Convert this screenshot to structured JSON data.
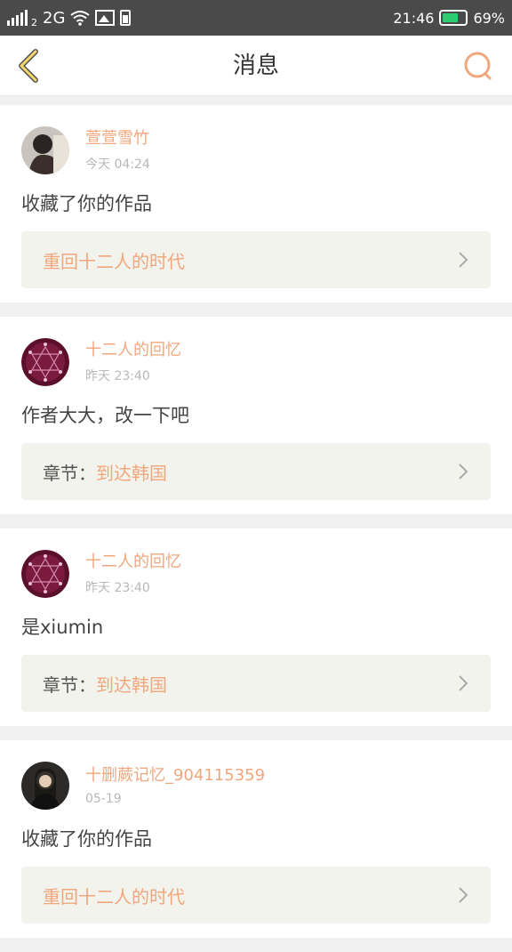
{
  "status_bar": {
    "network": "2G",
    "sim_index": "2",
    "time": "21:46",
    "battery_percent": "69%",
    "battery_level": 0.69,
    "battery_color": "#2ecc71"
  },
  "header": {
    "title": "消息",
    "back_icon": "chevron-left-icon",
    "search_icon": "search-icon",
    "accent": "#f0a77e"
  },
  "messages": [
    {
      "username": "萱萱雪竹",
      "time": "今天 04:24",
      "text": "收藏了你的作品",
      "link_prefix": "",
      "link_title": "重回十二人的时代"
    },
    {
      "username": "十二人的回忆",
      "time": "昨天 23:40",
      "text": "作者大大，改一下吧",
      "link_prefix": "章节：",
      "link_title": "到达韩国"
    },
    {
      "username": "十二人的回忆",
      "time": "昨天 23:40",
      "text": "是xiumin",
      "link_prefix": "章节：",
      "link_title": "到达韩国"
    },
    {
      "username": "十删蕨记忆_904115359",
      "time": "05-19",
      "text": "收藏了你的作品",
      "link_prefix": "",
      "link_title": "重回十二人的时代"
    }
  ]
}
